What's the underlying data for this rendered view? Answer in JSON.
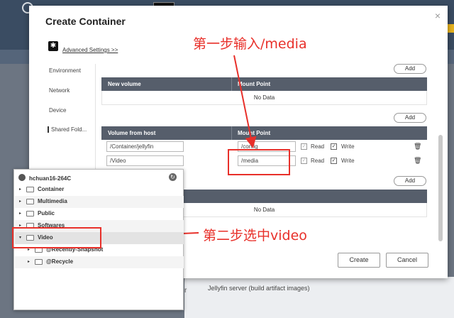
{
  "dialog": {
    "title": "Create Container",
    "close": "×",
    "advanced_link": "Advanced Settings >>",
    "sidebar": [
      "Environment",
      "Network",
      "Device",
      "Shared Fold..."
    ],
    "add_label": "Add",
    "new_volume_table": {
      "col1": "New volume",
      "col2": "Mount Point",
      "empty": "No Data"
    },
    "host_table": {
      "col1": "Volume from host",
      "col2": "Mount Point",
      "rows": [
        {
          "host": "/Container/jellyfin",
          "mount": "/config",
          "read": "Read",
          "write": "Write"
        },
        {
          "host": "/Video",
          "mount": "/media",
          "read": "Read",
          "write": "Write"
        }
      ]
    },
    "third_table": {
      "empty": "No Data"
    },
    "create": "Create",
    "cancel": "Cancel"
  },
  "annotations": {
    "step1": "第一步输入/media",
    "step2": "第二步选中video"
  },
  "tree": {
    "root": "hchuan16-264C",
    "items": [
      "Container",
      "Multimedia",
      "Public",
      "Softwares",
      "Video",
      "@Recently-Snapshot",
      "@Recycle"
    ]
  },
  "background": {
    "lower_text": "Jellyfin server (build artifact images)",
    "lower_mark": "r"
  },
  "icons": {
    "close": "close-icon",
    "gear": "gear-icon",
    "trash": "trash-icon",
    "folder": "folder-icon",
    "refresh": "refresh-icon",
    "checkbox": "checkbox-icon"
  },
  "colors": {
    "annotation": "#e8302a",
    "table_header": "#565e6b"
  }
}
